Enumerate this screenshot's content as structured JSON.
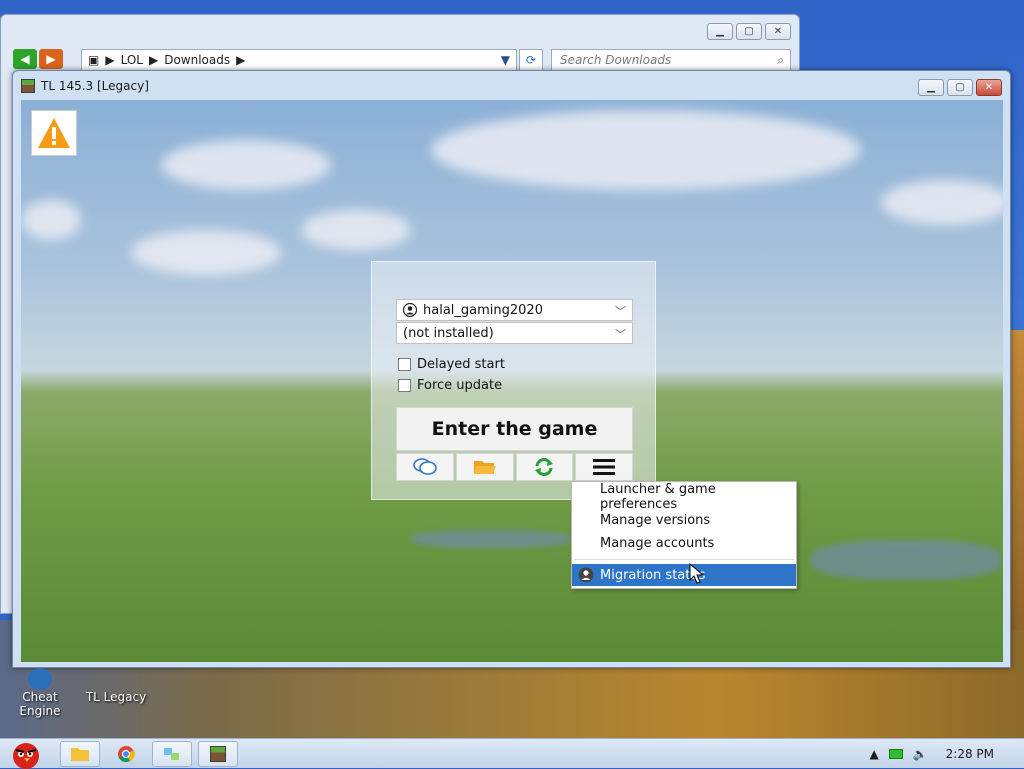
{
  "explorer": {
    "path": [
      "LOL",
      "Downloads"
    ],
    "search_placeholder": "Search Downloads"
  },
  "tl": {
    "title": "TL 145.3 [Legacy]",
    "account": "halal_gaming2020",
    "version": "(not installed)",
    "delayed_start": "Delayed start",
    "force_update": "Force update",
    "enter_button": "Enter the game"
  },
  "menu": {
    "items": [
      "Launcher & game preferences",
      "Manage versions",
      "Manage accounts",
      "Migration status"
    ],
    "highlight_color": "#2e74c9"
  },
  "desktop": {
    "icons": [
      "Cheat Engine",
      "TL Legacy"
    ]
  },
  "taskbar": {
    "time": "2:28 PM"
  }
}
